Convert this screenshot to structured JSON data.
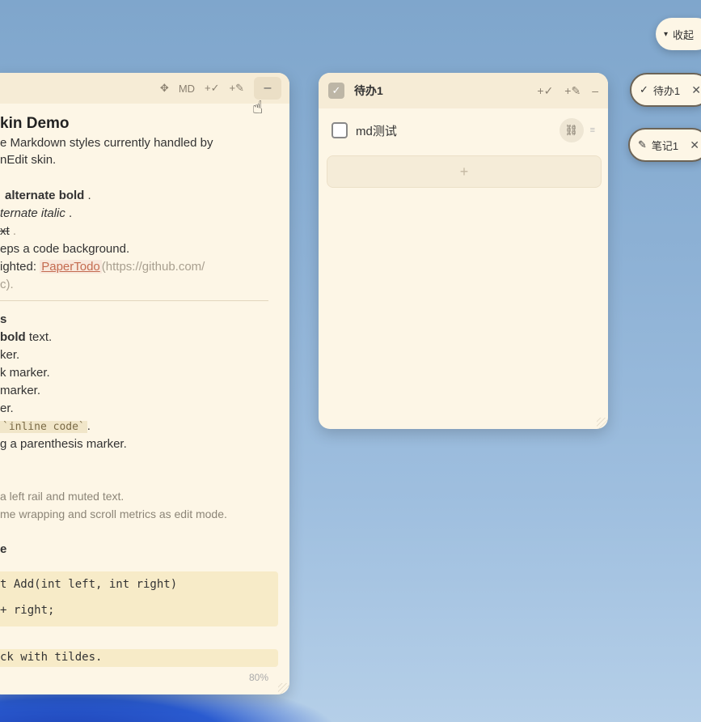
{
  "notes_panel": {
    "toolbar": {
      "move_icon": "✥",
      "md_label": "MD",
      "add_todo_label": "+✓",
      "add_note_label": "+✎",
      "minimize_label": "–"
    },
    "heading": "kin Demo",
    "lines": {
      "l1": "e Markdown styles currently handled by",
      "l2": "nEdit skin.",
      "l3_bold": "alternate bold",
      "l3_tail": ".",
      "l4_ital": "ternate italic",
      "l4_tail": ".",
      "l5": "xt",
      "l5_tail": ".",
      "l6": "eps a code background.",
      "l7_prefix": "ighted:",
      "l7_link": "PaperTodo",
      "l7_url": "(https://github.com/",
      "l8": "c).",
      "h2_lists": "s",
      "li1_bold": "bold",
      "li1_tail": "text.",
      "li2": "ker.",
      "li3": "k marker.",
      "li4": "marker.",
      "li5": "er.",
      "li6_code": "`inline code`",
      "li6_tail": ".",
      "li7": "g a parenthesis marker.",
      "q1": "a left rail and muted text.",
      "q2": "me wrapping and scroll metrics as edit mode.",
      "h2_code": "e",
      "c1": "t Add(int left, int right)",
      "c2": "+ right;",
      "c3": "ck with tildes."
    },
    "zoom": "80%"
  },
  "todo_panel": {
    "checkbox_icon": "✓",
    "title": "待办1",
    "toolbar": {
      "add_todo_label": "+✓",
      "add_note_label": "+✎",
      "minimize_label": "–"
    },
    "item": {
      "text": "md测试",
      "link_icon": "⛓",
      "drag_icon": "≡"
    },
    "add_label": "+"
  },
  "right_pills": {
    "collapse": {
      "arrow": "▾",
      "label": "收起"
    },
    "todo": {
      "icon": "✓",
      "label": "待办1",
      "close": "✕"
    },
    "note": {
      "icon": "✎",
      "label": "笔记1",
      "close": "✕"
    }
  }
}
